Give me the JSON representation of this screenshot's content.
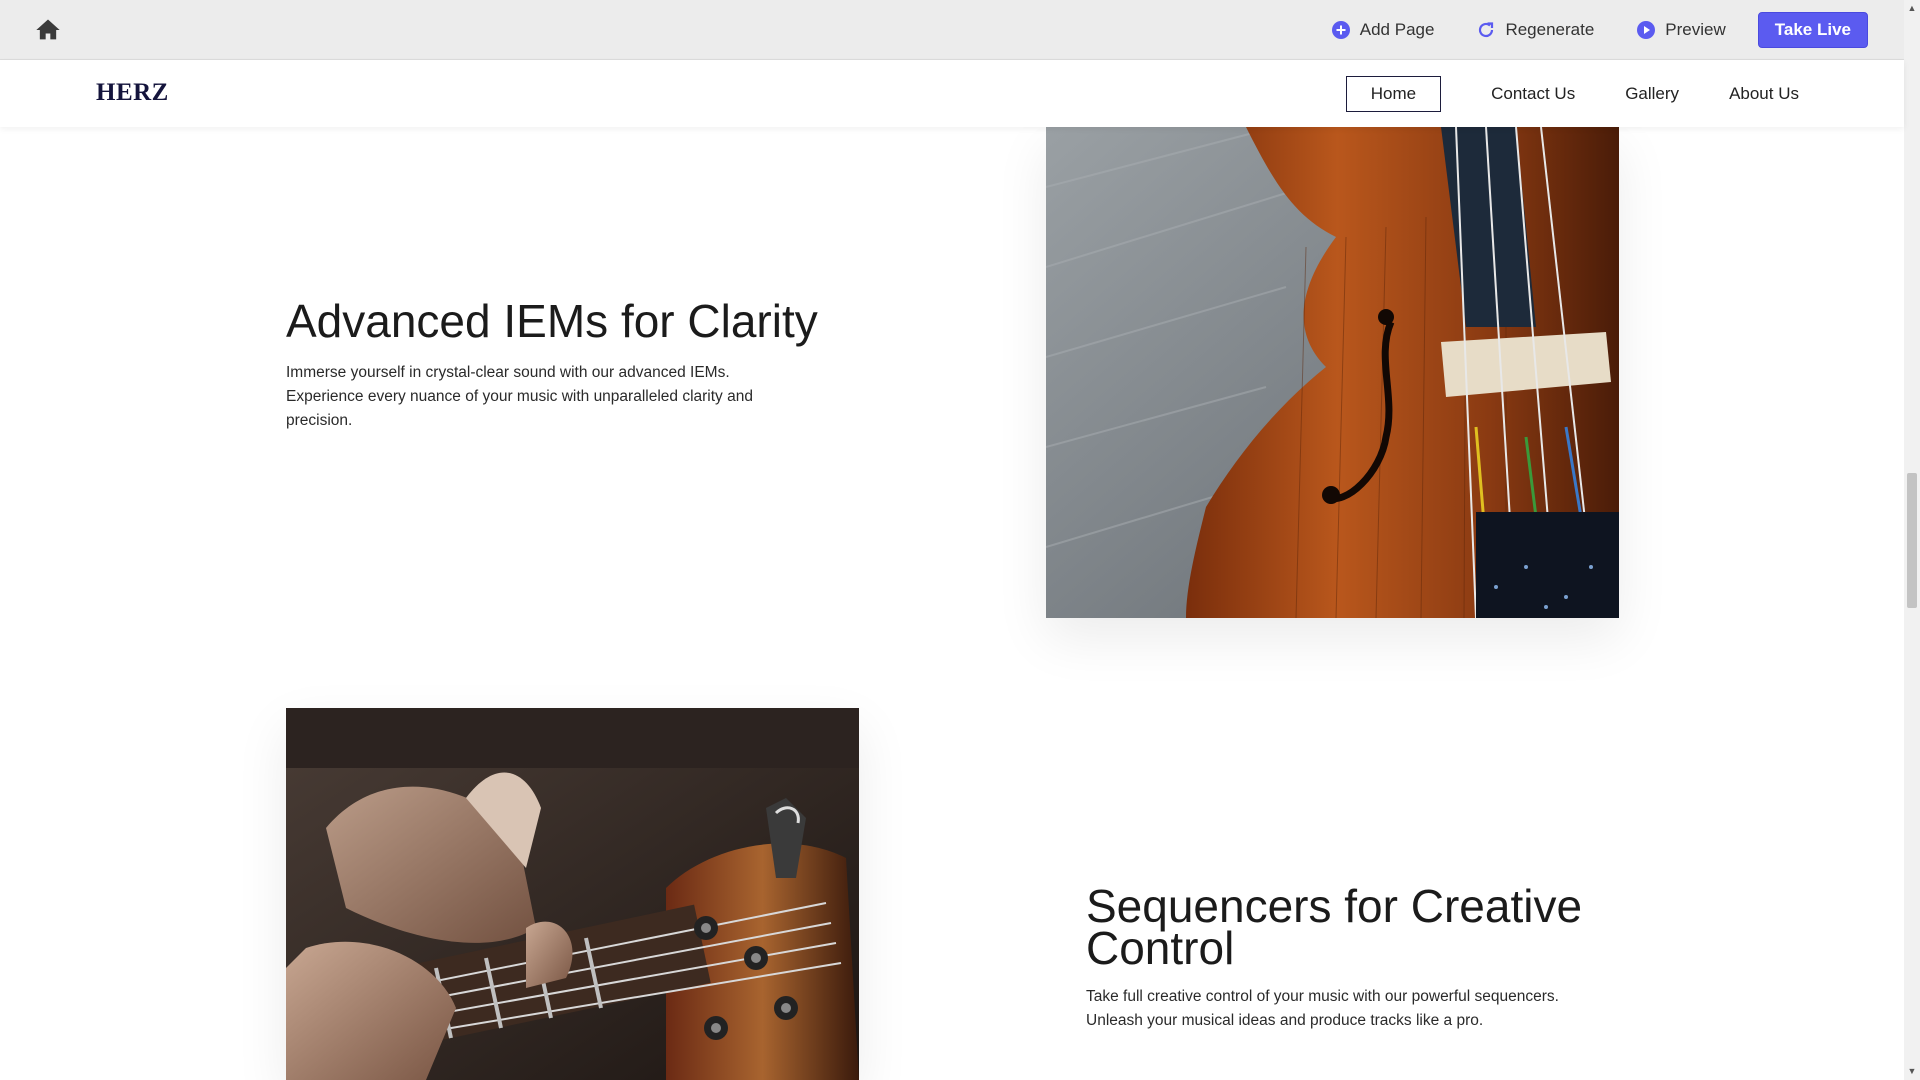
{
  "editor": {
    "actions": [
      {
        "label": "Add Page"
      },
      {
        "label": "Regenerate"
      },
      {
        "label": "Preview"
      }
    ],
    "take_live": "Take Live"
  },
  "site": {
    "logo": "HERZ",
    "nav": [
      "Home",
      "Contact Us",
      "Gallery",
      "About Us"
    ]
  },
  "sections": [
    {
      "title": "Advanced IEMs for Clarity",
      "text": "Immerse yourself in crystal-clear sound with our advanced IEMs. Experience every nuance of your music with unparalleled clarity and precision."
    },
    {
      "title": "Sequencers for Creative Control",
      "text": "Take full creative control of your music with our powerful sequencers. Unleash your musical ideas and produce tracks like a pro."
    }
  ],
  "colors": {
    "accent": "#5b5bf0",
    "logo": "#14143c",
    "toolbar_bg": "#ececec"
  }
}
